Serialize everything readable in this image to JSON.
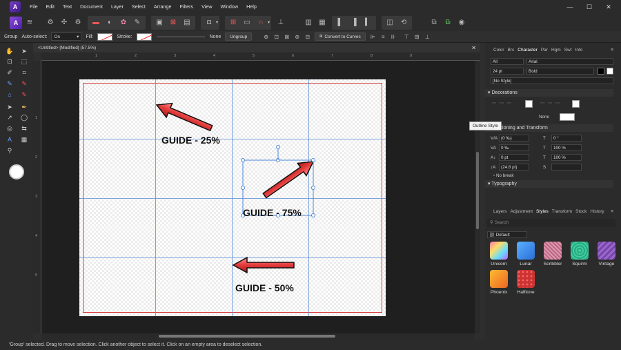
{
  "menubar": {
    "items": [
      "File",
      "Edit",
      "Text",
      "Document",
      "Layer",
      "Select",
      "Arrange",
      "Filters",
      "View",
      "Window",
      "Help"
    ]
  },
  "context": {
    "group": "Group",
    "autoselect_label": "Auto-select:",
    "autoselect_value": "On",
    "fill_label": "Fill:",
    "stroke_label": "Stroke:",
    "stroke_none": "None",
    "ungroup": "Ungroup",
    "convert": "Convert to Curves"
  },
  "document": {
    "tab_title": "<Untitled> [Modified] (57.5%)"
  },
  "ruler": {
    "h_ticks": [
      "1",
      "2",
      "3",
      "4",
      "5",
      "6",
      "7",
      "8",
      "9"
    ],
    "v_ticks": [
      "1",
      "2",
      "3",
      "4",
      "5"
    ]
  },
  "artboard": {
    "labels": {
      "g25": "GUIDE - 25%",
      "g75": "GUIDE - 75%",
      "g50": "GUIDE - 50%"
    }
  },
  "panel": {
    "top_tabs": [
      "Color",
      "Brs",
      "Character",
      "Par",
      "Hgm",
      "Swt",
      "Info"
    ],
    "active_top_tab": "Character",
    "font_collection": "All",
    "font_family": "Arial",
    "font_size": "24 pt",
    "font_weight": "Bold",
    "style": "[No Style]",
    "decorations_title": "Decorations",
    "decorations_none": "None",
    "positioning_title": "Positioning and Transform",
    "kerning": "(0 ‰)",
    "tracking": "0 ‰",
    "baseline": "0 pt",
    "leading": "(24.8 pt)",
    "shear": "0 °",
    "scale_h": "100 %",
    "scale_v": "100 %",
    "no_break": "No break",
    "typography_title": "Typography",
    "bottom_tabs": [
      "Layers",
      "Adjustment",
      "Styles",
      "Transform",
      "Stock",
      "History"
    ],
    "active_bottom_tab": "Styles",
    "search_placeholder": "Search",
    "styles_category": "Default",
    "styles": [
      "Unicorn",
      "Lunar",
      "Scribbler",
      "Squirm",
      "Vintage",
      "Phoenix",
      "Halftone"
    ]
  },
  "tooltip": "Outline Style",
  "status": {
    "text": "'Group' selected. Drag to move selection. Click another object to select it. Click on an empty area to deselect selection."
  },
  "colors": {
    "accent": "#7a3fc4",
    "guide": "#5b8fd6",
    "margin": "#d63a3a",
    "arrow": "#e03a3a"
  }
}
